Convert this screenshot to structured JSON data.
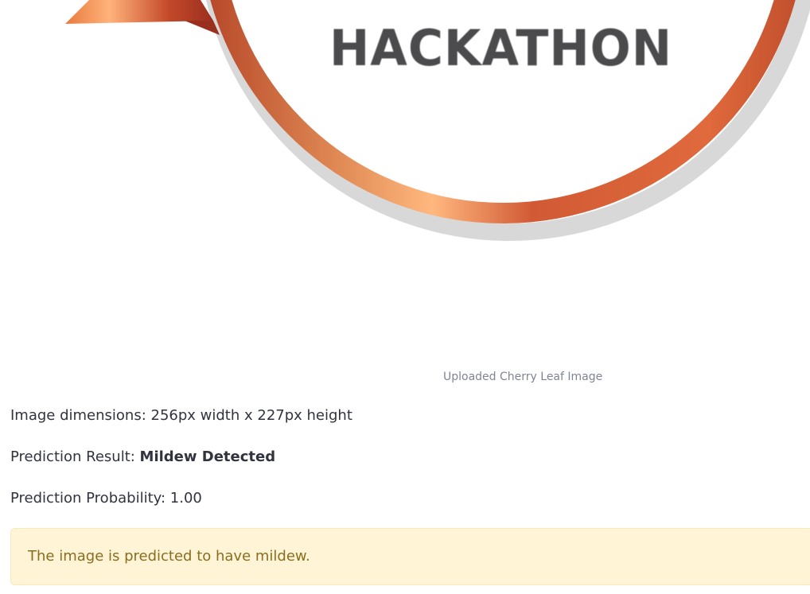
{
  "uploaded_image": {
    "logo_text": "HACKATHON",
    "caption": "Uploaded Cherry Leaf Image"
  },
  "details": {
    "dimensions_text": "Image dimensions: 256px width x 227px height",
    "prediction_label": "Prediction Result: ",
    "prediction_value": "Mildew Detected",
    "probability_text": "Prediction Probability: 1.00"
  },
  "alert": {
    "message": "The image is predicted to have mildew.",
    "type": "warning"
  },
  "colors": {
    "alert_background": "#fff5d6",
    "alert_text": "#8a6d1e",
    "ring_orange": "#d9683a",
    "ring_light": "#ffb47a"
  }
}
